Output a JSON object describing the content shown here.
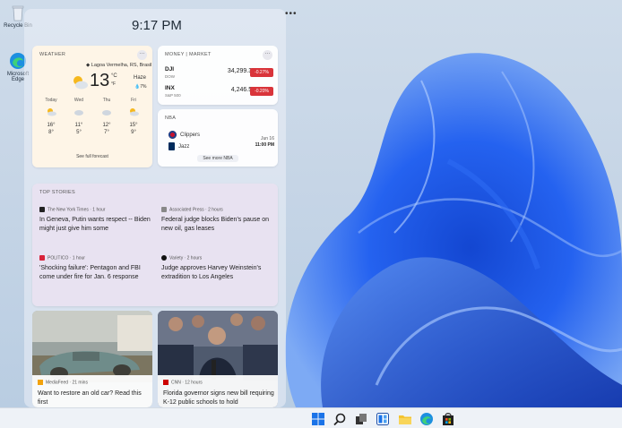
{
  "desktop": {
    "icons": [
      {
        "label": "Recycle Bin",
        "icon": "recycle-bin-icon"
      },
      {
        "label": "Microsoft Edge",
        "icon": "edge-icon"
      }
    ]
  },
  "widgets": {
    "time": "9:17 PM",
    "menu_glyph": "•••",
    "weather": {
      "title": "WEATHER",
      "location": "Lagoa Vermelha, RS, Brasil",
      "temp": "13",
      "unit_c": "°C",
      "unit_f": "°F",
      "condition": "Haze",
      "rain": "7%",
      "forecast": [
        {
          "day": "Today",
          "hi": "16°",
          "lo": "8°",
          "icon": "partly-cloudy-icon"
        },
        {
          "day": "Wed",
          "hi": "11°",
          "lo": "5°",
          "icon": "cloudy-icon"
        },
        {
          "day": "Thu",
          "hi": "12°",
          "lo": "7°",
          "icon": "cloudy-icon"
        },
        {
          "day": "Fri",
          "hi": "15°",
          "lo": "9°",
          "icon": "partly-sunny-icon"
        }
      ],
      "link": "See full forecast"
    },
    "market": {
      "title": "MONEY | MARKET",
      "stocks": [
        {
          "symbol": "DJI",
          "name": "DOW",
          "value": "34,299.33",
          "change": "-0.27%"
        },
        {
          "symbol": "INX",
          "name": "S&P 500",
          "value": "4,246.59",
          "change": "-0.20%"
        }
      ],
      "negative_color": "#d9343a"
    },
    "nba": {
      "title": "NBA",
      "teams": [
        "Clippers",
        "Jazz"
      ],
      "date": "Jun 16",
      "time": "11:00 PM",
      "link": "See more NBA"
    },
    "stories": {
      "title": "TOP STORIES",
      "items": [
        {
          "source": "The New York Times · 1 hour",
          "headline": "In Geneva, Putin wants respect -- Biden might just give him some"
        },
        {
          "source": "Associated Press · 2 hours",
          "headline": "Federal judge blocks Biden's pause on new oil, gas leases"
        },
        {
          "source": "POLITICO · 1 hour",
          "headline": "'Shocking failure': Pentagon and FBI come under fire for Jan. 6 response"
        },
        {
          "source": "Variety · 2 hours",
          "headline": "Judge approves Harvey Weinstein's extradition to Los Angeles"
        }
      ]
    },
    "photo_cards": [
      {
        "source": "MediaFeed · 21 mins",
        "headline": "Want to restore an old car? Read this first"
      },
      {
        "source": "CNN · 12 hours",
        "headline": "Florida governor signs new bill requiring K-12 public schools to hold"
      }
    ]
  },
  "taskbar": {
    "icons": [
      "start-icon",
      "search-icon",
      "task-view-icon",
      "widgets-icon",
      "file-explorer-icon",
      "edge-icon",
      "store-icon"
    ]
  }
}
